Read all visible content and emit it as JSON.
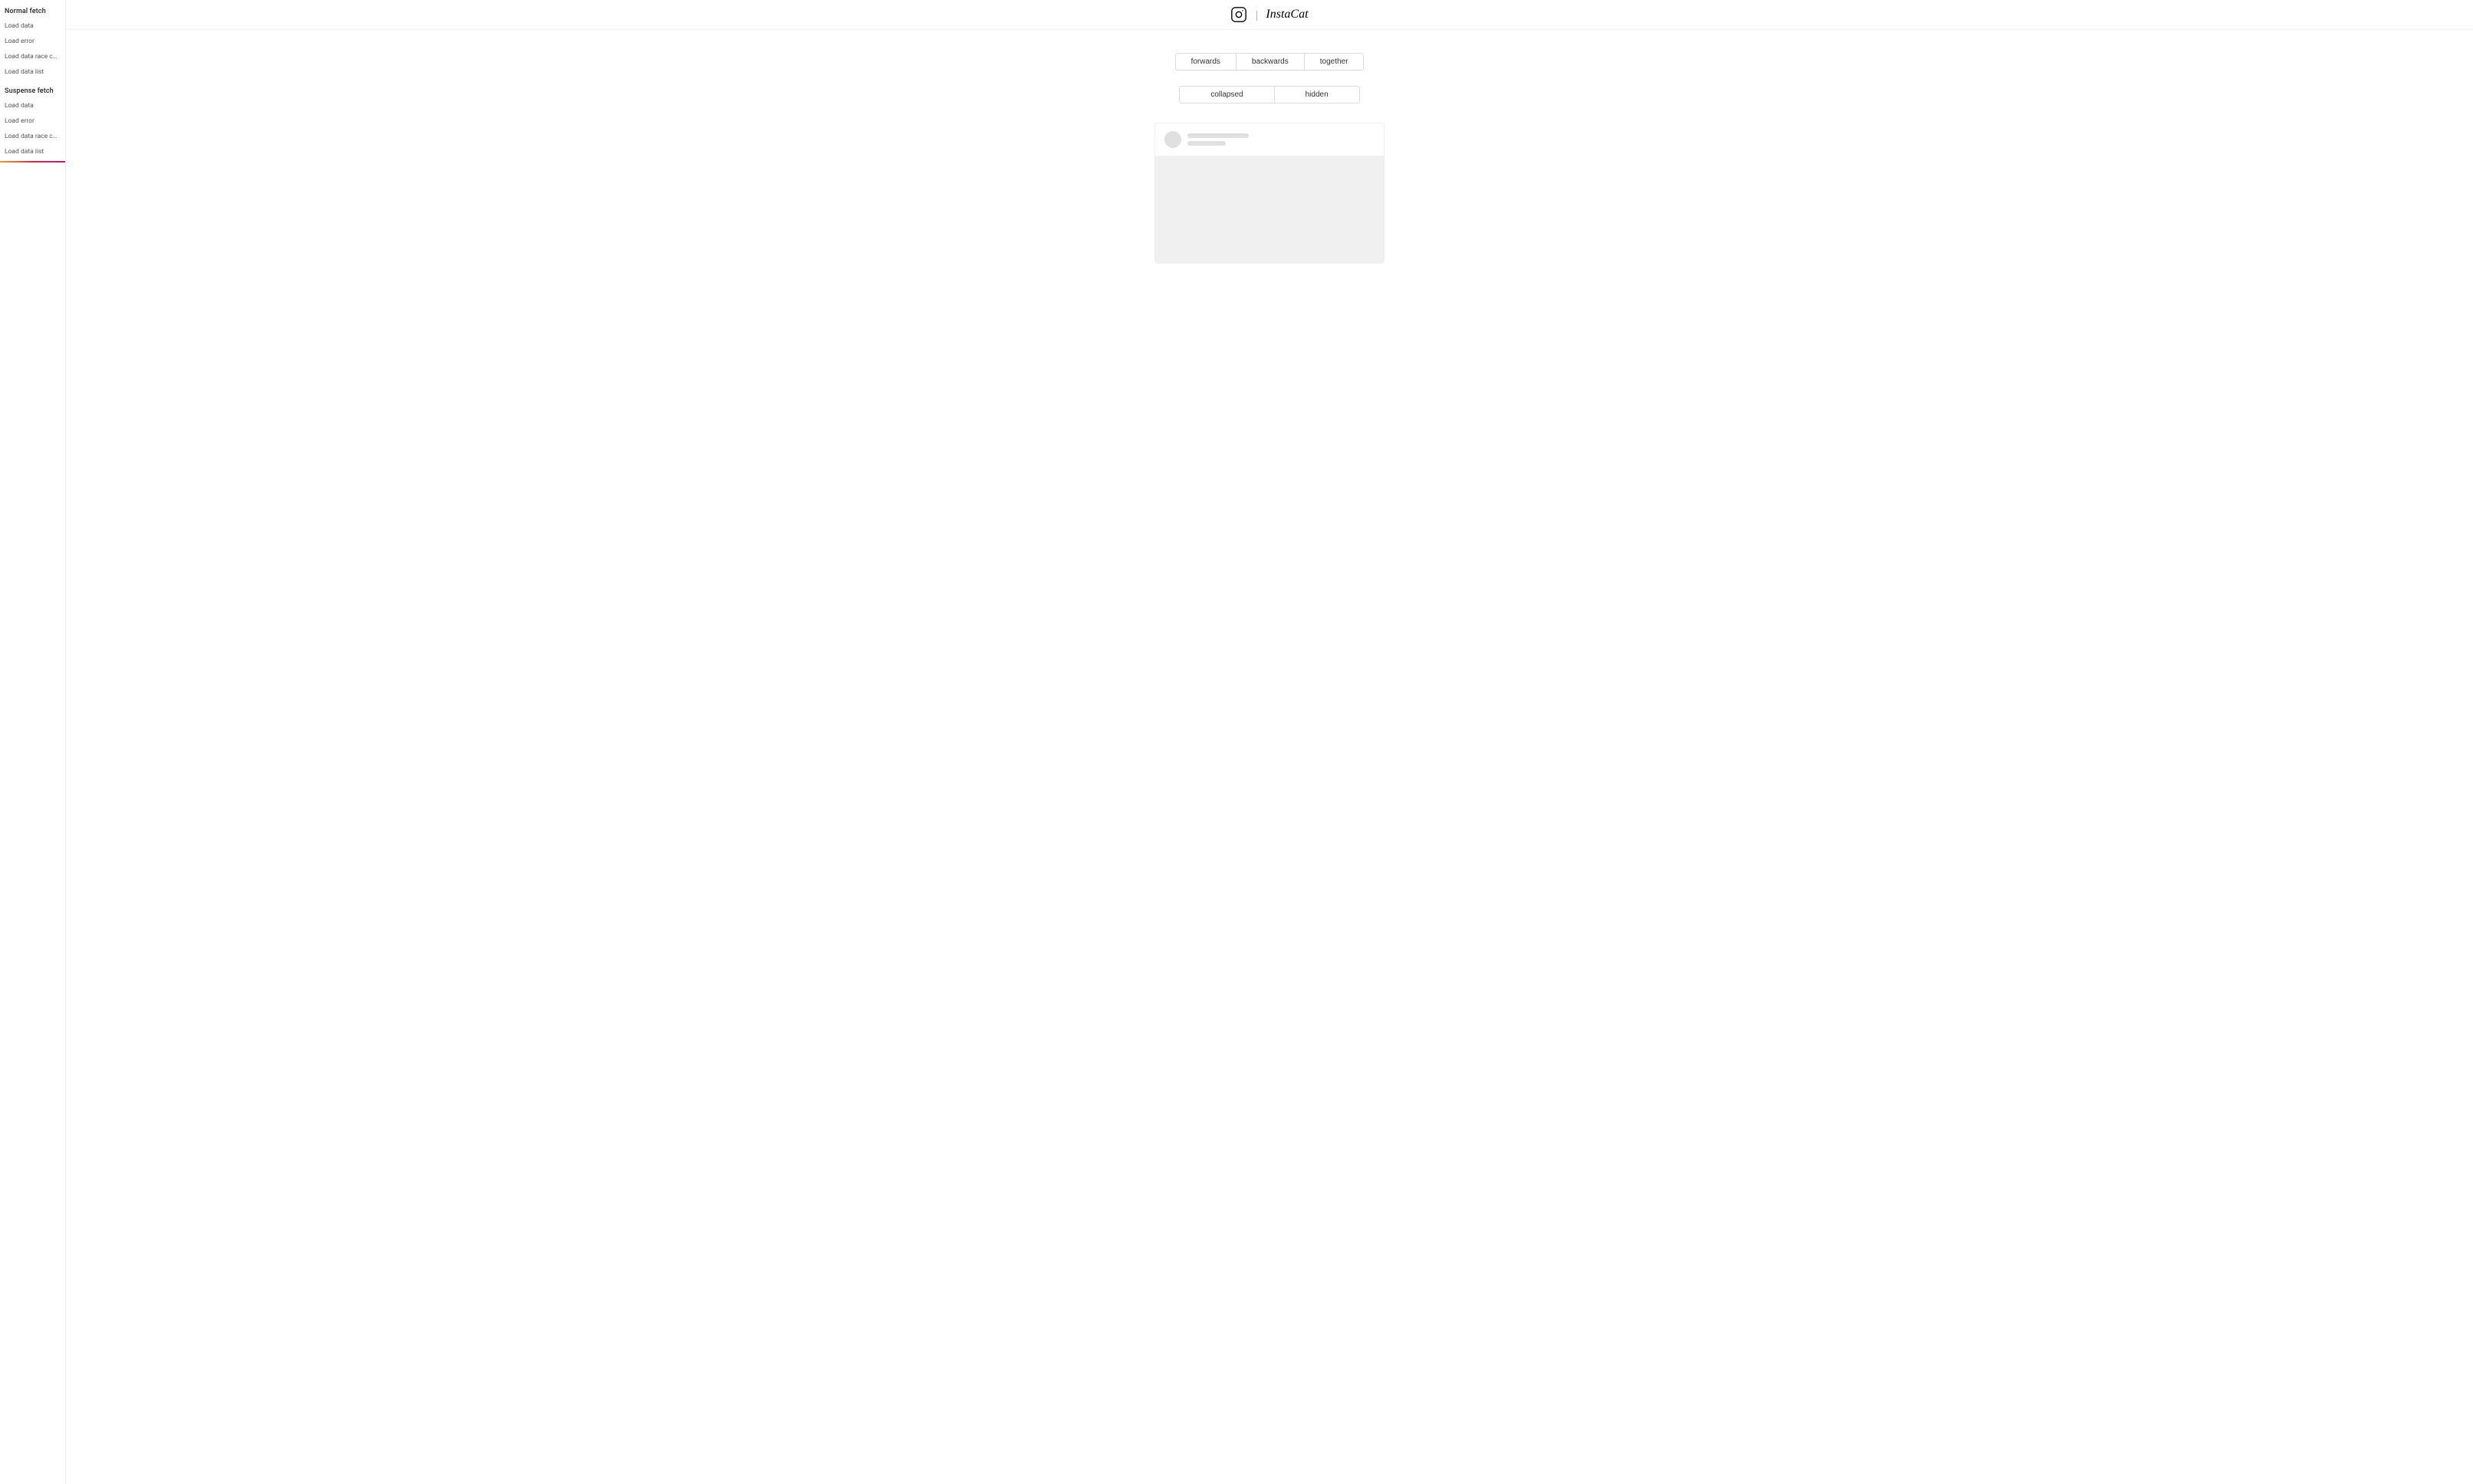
{
  "sidebar": {
    "sections": [
      {
        "label": "Normal fetch",
        "items": [
          "Load data",
          "Load error",
          "Load data race condition",
          "Load data list"
        ]
      },
      {
        "label": "Suspense fetch",
        "items": [
          "Load data",
          "Load error",
          "Load data race condition",
          "Load data list"
        ]
      }
    ]
  },
  "header": {
    "title": "InstaCat",
    "icon_label": "instagram-icon",
    "divider": "|"
  },
  "direction_buttons": [
    {
      "label": "forwards",
      "active": true
    },
    {
      "label": "backwards",
      "active": false
    },
    {
      "label": "together",
      "active": false
    }
  ],
  "visibility_buttons": [
    {
      "label": "collapsed",
      "active": true
    },
    {
      "label": "hidden",
      "active": false
    }
  ],
  "card": {
    "skeleton": true
  }
}
